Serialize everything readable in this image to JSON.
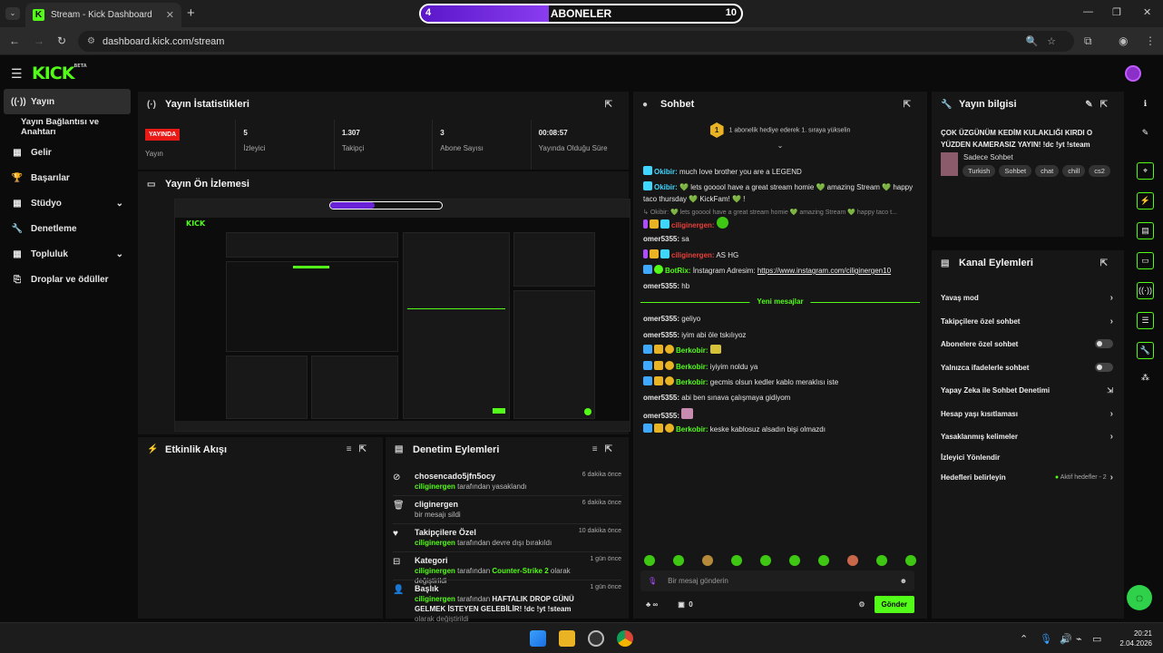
{
  "browser": {
    "tab_title": "Stream - Kick Dashboard",
    "tab_favicon": "K",
    "url": "dashboard.kick.com/stream"
  },
  "overlay": {
    "label": "ABONELER",
    "current": "4",
    "goal": "10",
    "progress": 0.4
  },
  "sidebar": {
    "items": [
      {
        "label": "Yayın",
        "icon": "broadcast-icon"
      },
      {
        "label": "Yayın Bağlantısı ve Anahtarı"
      },
      {
        "label": "Gelir",
        "icon": "chart-icon"
      },
      {
        "label": "Başarılar",
        "icon": "trophy-icon"
      },
      {
        "label": "Stüdyo",
        "icon": "grid-icon"
      },
      {
        "label": "Denetleme",
        "icon": "wrench-icon"
      },
      {
        "label": "Topluluk",
        "icon": "grid-icon"
      },
      {
        "label": "Droplar ve ödüller",
        "icon": "gift-icon"
      }
    ]
  },
  "stats": {
    "title": "Yayın İstatistikleri",
    "live_badge": "YAYINDA",
    "items": [
      {
        "value": "",
        "label": "Yayın"
      },
      {
        "value": "5",
        "label": "İzleyici"
      },
      {
        "value": "1.307",
        "label": "Takipçi"
      },
      {
        "value": "3",
        "label": "Abone Sayısı"
      },
      {
        "value": "00:08:57",
        "label": "Yayında Olduğu Süre"
      }
    ]
  },
  "preview": {
    "title": "Yayın Ön İzlemesi"
  },
  "activity": {
    "title": "Etkinlik Akışı"
  },
  "moderation": {
    "title": "Denetim Eylemleri",
    "rows": [
      {
        "title": "chosencado5jfn5ocy",
        "user": "ciliginergen",
        "text": "tarafından yasaklandı",
        "time": "6 dakika önce"
      },
      {
        "title": "cliginergen",
        "user": "",
        "text": "bir mesajı sildi",
        "time": "6 dakika önce"
      },
      {
        "title": "Takipçilere Özel",
        "user": "ciliginergen",
        "text": "tarafından devre dışı bırakıldı",
        "time": "10 dakika önce"
      },
      {
        "title": "Kategori",
        "user": "ciliginergen",
        "text": "tarafından",
        "game": "Counter-Strike 2",
        "text2": "olarak değiştirildi",
        "time": "1 gün önce"
      },
      {
        "title": "Başlık",
        "user": "ciliginergen",
        "text": "tarafından",
        "game": "HAFTALIK DROP GÜNÜ GELMEK İSTEYEN GELEBİLİR! !dc !yt !steam",
        "text2": "olarak değiştirildi",
        "time": "1 gün önce"
      }
    ]
  },
  "chat": {
    "title": "Sohbet",
    "pinned": "1 abonelik hediye ederek 1. sıraya yükselin",
    "pinned_badge": "1",
    "new_messages": "Yeni mesajlar",
    "messages": [
      {
        "user": "Okibir:",
        "text": "much love brother you are a LEGEND",
        "color": "#3fd7ff"
      },
      {
        "user": "Okibir:",
        "text": "💚 lets gooool have a great stream homie 💚 amazing Stream 💚 happy taco thursday 💚 KickFam! 💚 !",
        "color": "#3fd7ff"
      },
      {
        "user": "Okibir:",
        "text": "💚 lets gooool have a great stream homie 💚 amazing Stream 💚 happy taco t...",
        "color": "#888"
      },
      {
        "user": "ciliginergen:",
        "text": "",
        "color": "#e9403a"
      },
      {
        "user": "omer5355:",
        "text": "sa",
        "color": "#e6e6e6"
      },
      {
        "user": "ciliginergen:",
        "text": "AS HG",
        "color": "#e9403a"
      },
      {
        "user": "BotRix:",
        "text": "İnstagram Adresim:",
        "link": "https://www.instagram.com/ciliginergen10",
        "color": "#53fc18"
      },
      {
        "user": "omer5355:",
        "text": "hb",
        "color": "#e6e6e6"
      },
      {
        "user": "omer5355:",
        "text": "geliyo",
        "color": "#e6e6e6"
      },
      {
        "user": "omer5355:",
        "text": "iyim abi öle tskılıyoz",
        "color": "#e6e6e6"
      },
      {
        "user": "Berkobir:",
        "text": "",
        "color": "#53fc18"
      },
      {
        "user": "Berkobir:",
        "text": "iyiyim noldu ya",
        "color": "#53fc18"
      },
      {
        "user": "Berkobir:",
        "text": "gecmis olsun kedler kablo meraklısı iste",
        "color": "#53fc18"
      },
      {
        "user": "omer5355:",
        "text": "abi ben sınava çalışmaya gidiyom",
        "color": "#e6e6e6"
      },
      {
        "user": "omer5355:",
        "text": "",
        "color": "#e6e6e6"
      },
      {
        "user": "Berkobir:",
        "text": "keske kablosuz alsadın bişi olmazdı",
        "color": "#53fc18"
      }
    ],
    "input_placeholder": "Bir mesaj gönderin",
    "points": "∞",
    "gifts": "0",
    "send_label": "Gönder"
  },
  "stream_info": {
    "title": "Yayın bilgisi",
    "stream_title": "ÇOK ÜZGÜNÜM KEDİM KULAKLIĞI KIRDI O YÜZDEN KAMERASIZ YAYIN! !dc !yt !steam",
    "category": "Sadece Sohbet",
    "tags": [
      "Turkish",
      "Sohbet",
      "chat",
      "chill",
      "cs2"
    ]
  },
  "channel_actions": {
    "title": "Kanal Eylemleri",
    "rows": [
      {
        "label": "Yavaş mod",
        "control": "chevron"
      },
      {
        "label": "Takipçilere özel sohbet",
        "control": "chevron"
      },
      {
        "label": "Abonelere özel sohbet",
        "control": "toggle"
      },
      {
        "label": "Yalnızca ifadelerle sohbet",
        "control": "toggle"
      },
      {
        "label": "Yapay Zeka ile Sohbet Denetimi",
        "control": "external"
      },
      {
        "label": "Hesap yaşı kısıtlaması",
        "control": "chevron"
      },
      {
        "label": "Yasaklanmış kelimeler",
        "control": "chevron"
      },
      {
        "label": "İzleyici Yönlendir",
        "control": "none"
      },
      {
        "label": "Hedefleri belirleyin",
        "control": "chevron",
        "extra": "Aktif hedefler - 2"
      }
    ]
  },
  "taskbar": {
    "time": "20:21",
    "date": "2.04.2026"
  }
}
